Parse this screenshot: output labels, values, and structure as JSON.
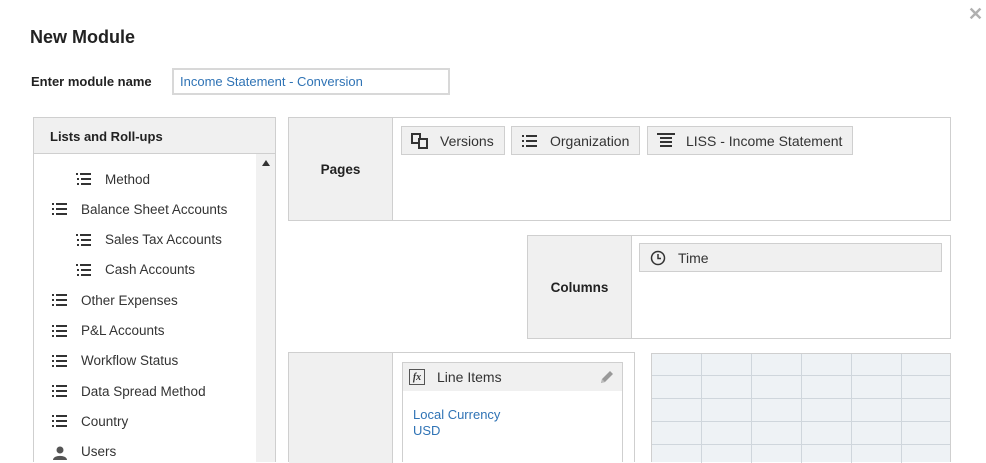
{
  "dialog": {
    "title": "New Module",
    "close_glyph": "✕"
  },
  "module_name": {
    "label": "Enter module name",
    "value": "Income Statement - Conversion"
  },
  "lists_panel": {
    "header": "Lists and Roll-ups",
    "items": [
      {
        "label": "Method",
        "level": 2,
        "icon": "hierarchy-list-icon"
      },
      {
        "label": "Balance Sheet Accounts",
        "level": 1,
        "icon": "list-icon"
      },
      {
        "label": "Sales Tax Accounts",
        "level": 2,
        "icon": "hierarchy-list-icon"
      },
      {
        "label": "Cash Accounts",
        "level": 2,
        "icon": "hierarchy-list-icon"
      },
      {
        "label": "Other Expenses",
        "level": 1,
        "icon": "list-icon"
      },
      {
        "label": "P&L Accounts",
        "level": 1,
        "icon": "list-icon"
      },
      {
        "label": "Workflow Status",
        "level": 1,
        "icon": "list-icon"
      },
      {
        "label": "Data Spread Method",
        "level": 1,
        "icon": "list-icon"
      },
      {
        "label": "Country",
        "level": 1,
        "icon": "list-icon"
      },
      {
        "label": "Users",
        "level": 1,
        "icon": "user-icon"
      }
    ]
  },
  "pages": {
    "label": "Pages",
    "chips": [
      {
        "label": "Versions",
        "icon": "versions-icon"
      },
      {
        "label": "Organization",
        "icon": "list-icon"
      },
      {
        "label": "LISS - Income Statement",
        "icon": "line-item-subset-icon"
      }
    ]
  },
  "columns": {
    "label": "Columns",
    "chips": [
      {
        "label": "Time",
        "icon": "clock-icon"
      }
    ]
  },
  "rows": {
    "line_items": {
      "header": "Line Items",
      "icon": "fx-icon",
      "values": [
        "Local Currency",
        "USD"
      ]
    }
  },
  "colors": {
    "accent_text": "#2f73b5",
    "panel_bg": "#f0f0f0",
    "border": "#cfcfcf",
    "grid_bg": "#eef2f5"
  }
}
